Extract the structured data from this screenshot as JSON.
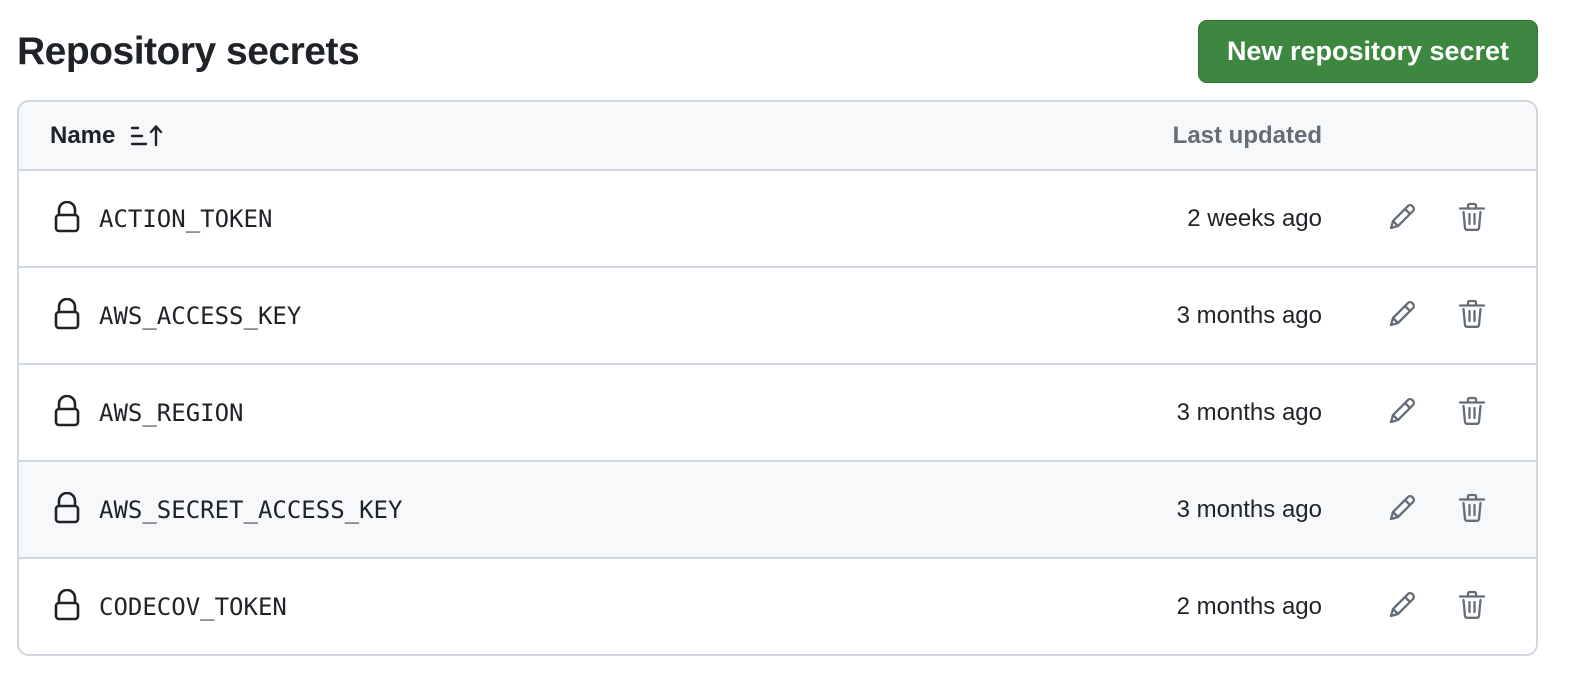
{
  "header": {
    "title": "Repository secrets",
    "new_button_label": "New repository secret"
  },
  "table": {
    "columns": {
      "name": "Name",
      "last_updated": "Last updated"
    },
    "rows": [
      {
        "name": "ACTION_TOKEN",
        "updated": "2 weeks ago"
      },
      {
        "name": "AWS_ACCESS_KEY",
        "updated": "3 months ago"
      },
      {
        "name": "AWS_REGION",
        "updated": "3 months ago"
      },
      {
        "name": "AWS_SECRET_ACCESS_KEY",
        "updated": "3 months ago"
      },
      {
        "name": "CODECOV_TOKEN",
        "updated": "2 months ago"
      }
    ]
  },
  "icons": {
    "row_icon": "lock-icon",
    "sort_icon": "sort-ascending-icon",
    "edit_icon": "pencil-icon",
    "delete_icon": "trash-icon"
  },
  "colors": {
    "primary_button": "#3e8741",
    "border": "#d0d7de",
    "header_bg": "#f6f8fa",
    "muted_text": "#656d76"
  }
}
